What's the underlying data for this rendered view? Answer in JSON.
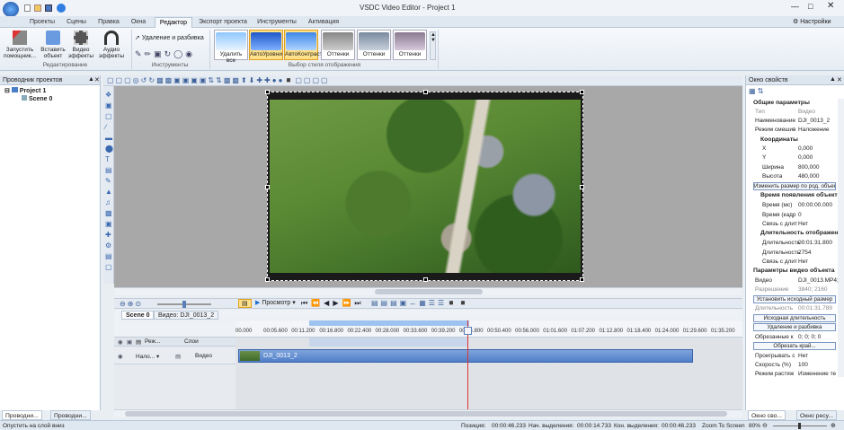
{
  "app": {
    "title": "VSDC Video Editor - Project 1",
    "settings_label": "Настройки"
  },
  "menu": {
    "tabs": [
      {
        "label": "Проекты"
      },
      {
        "label": "Сцены"
      },
      {
        "label": "Правка"
      },
      {
        "label": "Окна"
      },
      {
        "label": "Редактор"
      },
      {
        "label": "Экспорт проекта"
      },
      {
        "label": "Инструменты"
      },
      {
        "label": "Активация"
      }
    ],
    "active": "Редактор"
  },
  "ribbon": {
    "run_wizard": "Запустить помощник...",
    "insert_object": "Вставить объект",
    "video_effects": "Видео эффекты",
    "audio_effects": "Аудио эффекты",
    "group_editing": "Редактирование",
    "delete_split": "Удаление и разбивка",
    "group_tools": "Инструменты",
    "group_style": "Выбор стиля отображения",
    "styles": [
      {
        "label": "Удалить все"
      },
      {
        "label": "АвтоУровни"
      },
      {
        "label": "АвтоКонтраст"
      },
      {
        "label": "Оттенки"
      },
      {
        "label": "Оттенки"
      },
      {
        "label": "Оттенки"
      }
    ]
  },
  "left_panel": {
    "title": "Проводник проектов",
    "project": "Project 1",
    "scene": "Scene 0",
    "tabs": [
      {
        "label": "Проводни..."
      },
      {
        "label": "Проводни..."
      }
    ]
  },
  "right_panel": {
    "title": "Окно свойств",
    "general_section": "Общие параметры",
    "type_label": "Тип",
    "type_value": "Видео",
    "name_label": "Наименование",
    "name_value": "DJI_0013_2",
    "blend_label": "Режим смешив",
    "blend_value": "Наложение",
    "coords_section": "Координаты",
    "x_label": "X",
    "x_value": "0,000",
    "y_label": "Y",
    "y_value": "0,000",
    "width_label": "Ширина",
    "width_value": "800,000",
    "height_label": "Высота",
    "height_value": "480,000",
    "resize_btn": "Изменить размер по род. объекту",
    "appear_section": "Время появления объект",
    "time_ms_label": "Время (мс)",
    "time_ms_value": "00:00:00.000",
    "time_frame_label": "Время (кадр",
    "time_frame_value": "0",
    "link_label": "Связь с длит",
    "link_value": "Нет",
    "duration_section": "Длительность отображен",
    "dur_ms_label": "Длительность",
    "dur_ms_value": "00:01:31.800",
    "dur_frame_label": "Длительность",
    "dur_frame_value": "2754",
    "link2_label": "Связь с длит",
    "link2_value": "Нет",
    "video_section": "Параметры видео объекта",
    "video_label": "Видео",
    "video_value": "DJI_0013.MP4;",
    "res_label": "Разрешение",
    "res_value": "3840; 2160",
    "set_orig_btn": "Установить исходный размер",
    "orig_dur_label": "Длительность",
    "orig_dur_value": "00:01:31.789",
    "orig_dur_btn": "Исходная длительность",
    "del_split_btn": "Удаление и разбивка",
    "crop_label": "Обрезанные к",
    "crop_value": "0; 0; 0; 0",
    "crop_btn": "Обрезать край...",
    "play_label": "Проигрывать с",
    "play_value": "Нет",
    "speed_label": "Скорость (%)",
    "speed_value": "100",
    "stretch_label": "Режим растяж",
    "stretch_value": "Изменение те",
    "tabs": [
      {
        "label": "Окно сво..."
      },
      {
        "label": "Окно ресу..."
      }
    ]
  },
  "timeline": {
    "preview_label": "Просмотр",
    "tabs": [
      {
        "label": "Scene 0"
      },
      {
        "label": "Видео: DJI_0013_2"
      }
    ],
    "mode_label": "Реж...",
    "layers_label": "Слои",
    "blend_track": "Нало...",
    "track_name": "Видео",
    "clip_name": "DJI_0013_2",
    "ticks": [
      "00.000",
      "00:05.600",
      "00:11.200",
      "00:16.800",
      "00:22.400",
      "00:28.000",
      "00:33.600",
      "00:39.200",
      "00:44.800",
      "00:50.400",
      "00:56.000",
      "01:01.600",
      "01:07.200",
      "01:12.800",
      "01:18.400",
      "01:24.000",
      "01:29.600",
      "01:35.200"
    ]
  },
  "status": {
    "left": "Опустить на слой вниз",
    "position_label": "Позиция:",
    "position_value": "00:00:46.233",
    "sel_start_label": "Нач. выделения:",
    "sel_start_value": "00:00:14.733",
    "sel_end_label": "Кон. выделения:",
    "sel_end_value": "00:00:46.233",
    "zoom_label": "Zoom To Screen",
    "zoom_value": "80%"
  },
  "colors": {
    "accent": "#1f6fd1",
    "playhead": "#e03030"
  }
}
